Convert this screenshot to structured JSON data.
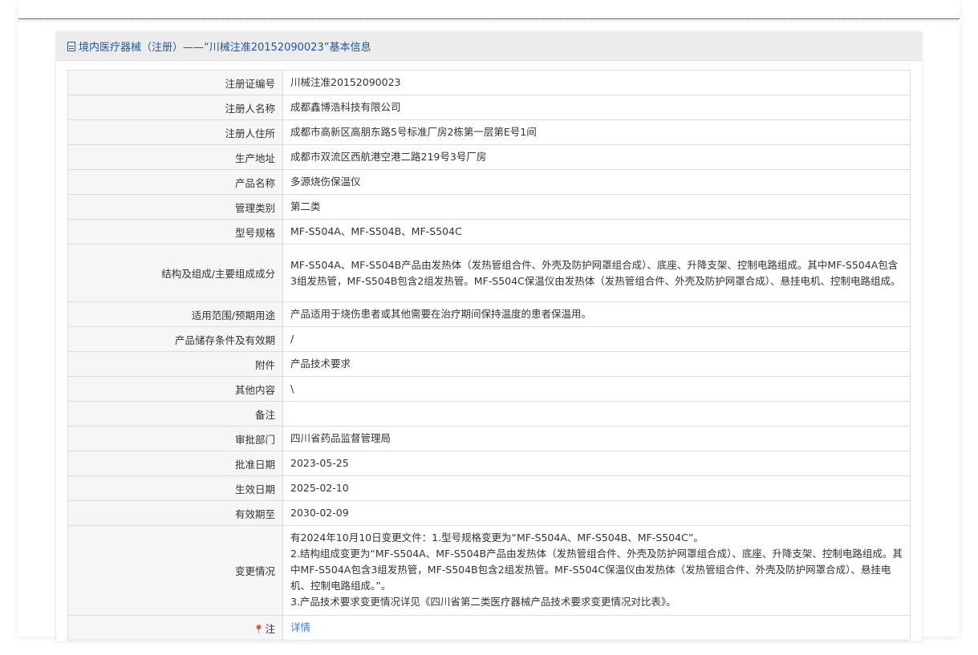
{
  "header": {
    "title": "境内医疗器械（注册）——“川械注准20152090023”基本信息"
  },
  "rows": [
    {
      "label": "注册证编号",
      "value": "川械注准20152090023"
    },
    {
      "label": "注册人名称",
      "value": "成都鑫博浩科技有限公司"
    },
    {
      "label": "注册人住所",
      "value": "成都市高新区高朋东路5号标准厂房2栋第一层第E号1间"
    },
    {
      "label": "生产地址",
      "value": "成都市双流区西航港空港二路219号3号厂房"
    },
    {
      "label": "产品名称",
      "value": "多源烧伤保温仪"
    },
    {
      "label": "管理类别",
      "value": "第二类"
    },
    {
      "label": "型号规格",
      "value": "MF-S504A、MF-S504B、MF-S504C"
    },
    {
      "label": "结构及组成/主要组成成分",
      "value": "MF-S504A、MF-S504B产品由发热体（发热管组合件、外壳及防护网罩组合成）、底座、升降支架、控制电路组成。其中MF-S504A包含3组发热管，MF-S504B包含2组发热管。MF-S504C保温仪由发热体（发热管组合件、外壳及防护网罩合成）、悬挂电机、控制电路组成。"
    },
    {
      "label": "适用范围/预期用途",
      "value": "产品适用于烧伤患者或其他需要在治疗期间保持温度的患者保温用。"
    },
    {
      "label": "产品储存条件及有效期",
      "value": "/"
    },
    {
      "label": "附件",
      "value": "产品技术要求"
    },
    {
      "label": "其他内容",
      "value": "\\"
    },
    {
      "label": "备注",
      "value": ""
    },
    {
      "label": "审批部门",
      "value": "四川省药品监督管理局"
    },
    {
      "label": "批准日期",
      "value": "2023-05-25"
    },
    {
      "label": "生效日期",
      "value": "2025-02-10"
    },
    {
      "label": "有效期至",
      "value": "2030-02-09"
    }
  ],
  "changes": {
    "label": "变更情况",
    "line1": "有2024年10月10日变更文件：1.型号规格变更为“MF-S504A、MF-S504B、MF-S504C”。",
    "line2": "2.结构组成变更为“MF-S504A、MF-S504B产品由发热体（发热管组合件、外壳及防护网罩组合成）、底座、升降支架、控制电路组成。其中MF-S504A包含3组发热管，MF-S504B包含2组发热管。MF-S504C保温仪由发热体（发热管组合件、外壳及防护网罩合成）、悬挂电机、控制电路组成。”。",
    "line3": "3.产品技术要求变更情况详见《四川省第二类医疗器械产品技术要求变更情况对比表》。"
  },
  "note_row": {
    "label": "注",
    "icon": "pin-icon",
    "link_text": "详情"
  },
  "colors": {
    "header_text": "#1b56a5",
    "link": "#3a7fd6",
    "label_bg": "#f6f6f6",
    "border": "#dcdcdc"
  }
}
